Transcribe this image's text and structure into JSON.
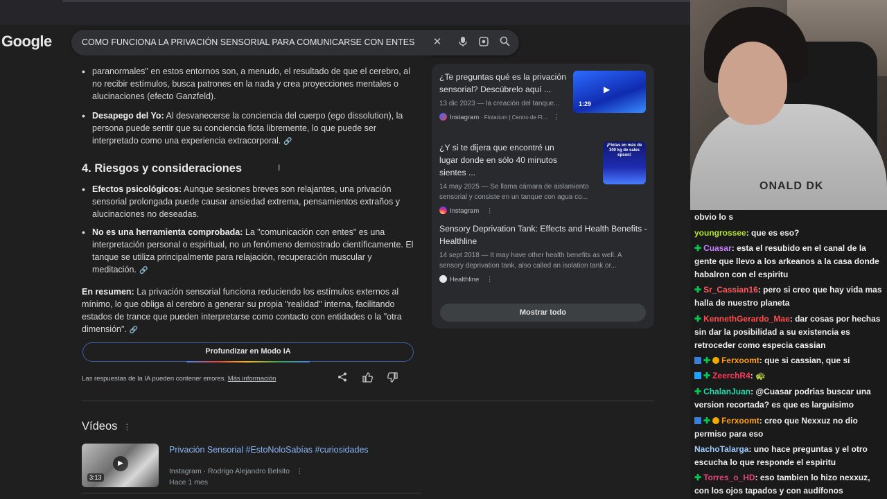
{
  "browser": {
    "logo": "Google",
    "search_query": "COMO FUNCIONA LA PRIVACIÓN SENSORIAL PARA COMUNICARSE CON ENTES",
    "icons": [
      "close-icon",
      "microphone-icon",
      "lens-icon",
      "search-icon"
    ]
  },
  "ai_overview": {
    "top_paragraph_tail": "paranormales\" en estos entornos son, a menudo, el resultado de que el cerebro, al no recibir estímulos, busca patrones en la nada y crea proyecciones mentales o alucinaciones (efecto Ganzfeld).",
    "bullet_ego_title": "Desapego del Yo:",
    "bullet_ego_text": " Al desvanecerse la conciencia del cuerpo (ego dissolution), la persona puede sentir que su conciencia flota libremente, lo que puede ser interpretado como una experiencia extracorporal.",
    "section_heading": "4. Riesgos y consideraciones",
    "bullet_psy_title": "Efectos psicológicos:",
    "bullet_psy_text": " Aunque sesiones breves son relajantes, una privación sensorial prolongada puede causar ansiedad extrema, pensamientos extraños y alucinaciones no deseadas.",
    "bullet_tool_title": "No es una herramienta comprobada:",
    "bullet_tool_text": " La \"comunicación con entes\" es una interpretación personal o espiritual, no un fenómeno demostrado científicamente. El tanque se utiliza principalmente para relajación, recuperación muscular y meditación.",
    "summary_title": "En resumen:",
    "summary_text": " La privación sensorial funciona reduciendo los estímulos externos al mínimo, lo que obliga al cerebro a generar su propia \"realidad\" interna, facilitando estados de trance que pueden interpretarse como contacto con entidades o la \"otra dimensión\".",
    "deep_dive_button": "Profundizar en Modo IA",
    "disclaimer": "Las respuestas de la IA pueden contener errores.",
    "more_info_link": "Más información"
  },
  "sources": {
    "items": [
      {
        "title": "¿Te preguntas qué es la privación sensorial? Descúbrelo aquí ...",
        "desc": "13 dic 2023 — la creación del tanque...",
        "site": "Instagram",
        "sub": "· Flotarium | Centro de Fl...",
        "thumb_duration": "1:29"
      },
      {
        "title": "¿Y si te dijera que encontré un lugar donde en sólo 40 minutos sientes ...",
        "desc": "14 may 2025 — Se llama cámara de aislamiento sensorial y consiste en un tanque con agua co...",
        "site": "Instagram",
        "thumb_text": "¡Flotas en más de 300 kg de sales epson!"
      },
      {
        "title": "Sensory Deprivation Tank: Effects and Health Benefits - Healthline",
        "desc": "14 sept 2018 — It may have other health benefits as well. A sensory deprivation tank, also called an isolation tank or...",
        "site": "Healthline"
      }
    ],
    "show_all": "Mostrar todo"
  },
  "videos": {
    "heading": "Vídeos",
    "item_title": "Privación Sensorial #EstoNoloSabías #curiosidades",
    "item_source": "Instagram · Rodrigo Alejandro Belsito",
    "item_age": "Hace 1 mes",
    "item_duration": "3:13"
  },
  "webcam": {
    "hoodie_text": "ONALD DK"
  },
  "chat": {
    "messages": [
      {
        "user": "",
        "text": "obvio lo s",
        "color": "#efeff1"
      },
      {
        "user": "youngrossee",
        "text": ": que es eso?",
        "color": "#b6e52b"
      },
      {
        "user": "Cuasar",
        "text": ": esta el resubido en el canal de la gente que llevo a los arkeanos a la casa donde habalron con el espiritu",
        "color": "#c77dff"
      },
      {
        "user": "Sr_Cassian16",
        "text": ": pero si creo que hay vida mas halla de nuestro planeta",
        "color": "#ff5a5f"
      },
      {
        "user": "KennethGerardo_Mae",
        "text": ": dar cosas por hechas sin dar la posibilidad a su existencia es retroceder como especia cassian",
        "color": "#ff4d4d"
      },
      {
        "user": "Ferxoomt",
        "text": ": que si cassian, que si",
        "color": "#ff9f1a"
      },
      {
        "user": "ZeerchR4",
        "text": ": 🐢",
        "color": "#ff3b5c"
      },
      {
        "user": "ChalanJuan",
        "text": ": @Cuasar podrias buscar una version recortada? es que es larguisimo",
        "color": "#2bd9a8"
      },
      {
        "user": "Ferxoomt",
        "text": ": creo que Nexxuz no dio permiso para eso",
        "color": "#ff9f1a"
      },
      {
        "user": "NachoTalarga",
        "text": ": uno hace preguntas y el otro escucha lo que responde el espiritu",
        "color": "#9ecbff"
      },
      {
        "user": "Torres_o_HD",
        "text": ": eso tambien lo hizo nexxuz, con los ojos tapados y con audífonos",
        "color": "#e0457b"
      }
    ]
  }
}
